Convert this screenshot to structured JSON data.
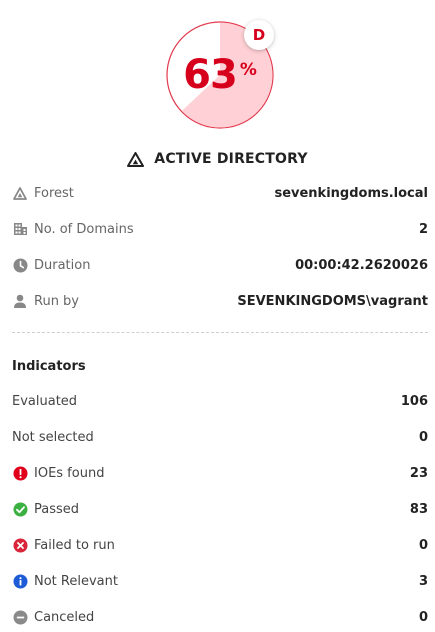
{
  "score": {
    "value": "63",
    "unit": "%",
    "grade": "D",
    "fraction": 0.63,
    "fill_color": "#ffd1d6",
    "ring_color": "#e23a4e",
    "text_color": "#d6001c"
  },
  "section": {
    "title": "ACTIVE DIRECTORY",
    "icon": "triangle-warning-icon"
  },
  "details": [
    {
      "icon": "triangle-icon",
      "label": "Forest",
      "value": "sevenkingdoms.local"
    },
    {
      "icon": "building-icon",
      "label": "No. of Domains",
      "value": "2"
    },
    {
      "icon": "clock-icon",
      "label": "Duration",
      "value": "00:00:42.2620026"
    },
    {
      "icon": "user-icon",
      "label": "Run by",
      "value": "SEVENKINGDOMS\\vagrant"
    }
  ],
  "indicators": {
    "title": "Indicators",
    "rows": [
      {
        "icon": "",
        "label": "Evaluated",
        "value": "106"
      },
      {
        "icon": "",
        "label": "Not selected",
        "value": "0"
      },
      {
        "icon": "exclamation-icon",
        "label": "IOEs found",
        "value": "23",
        "color": "#e0001b"
      },
      {
        "icon": "check-icon",
        "label": "Passed",
        "value": "83",
        "color": "#3cb043"
      },
      {
        "icon": "x-circle-icon",
        "label": "Failed to run",
        "value": "0",
        "color": "#d9243a"
      },
      {
        "icon": "info-icon",
        "label": "Not Relevant",
        "value": "3",
        "color": "#1e5bd6"
      },
      {
        "icon": "minus-circle-icon",
        "label": "Canceled",
        "value": "0",
        "color": "#8a8a8a"
      }
    ]
  }
}
